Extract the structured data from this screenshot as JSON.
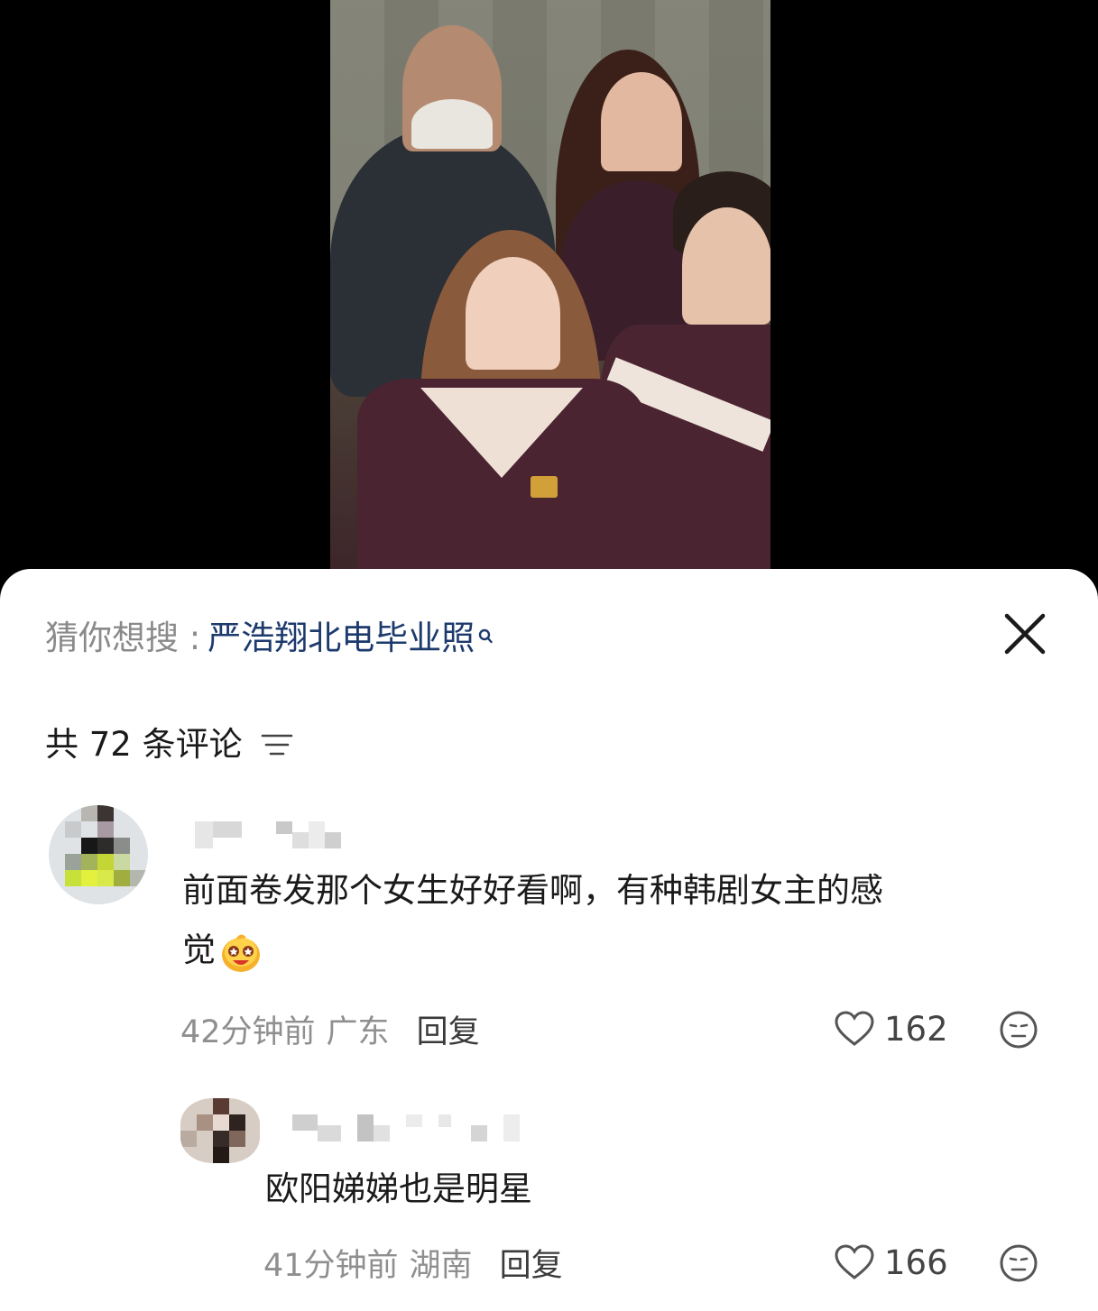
{
  "search_suggestion": {
    "label": "猜你想搜 : ",
    "query": "严浩翔北电毕业照",
    "accent_color": "#1d3a6d"
  },
  "comments_header": {
    "count_text": "共 72 条评论"
  },
  "comments": [
    {
      "text_line1": "前面卷发那个女生好好看啊，有种韩剧女主的感",
      "text_line2": "觉",
      "emoji": "star-eyes-smiley-emoji",
      "time": "42分钟前",
      "location": "广东",
      "reply_label": "回复",
      "likes": "162"
    },
    {
      "text": "欧阳娣娣也是明星",
      "time": "41分钟前",
      "location": "湖南",
      "reply_label": "回复",
      "likes": "166"
    }
  ],
  "icons": {
    "close": "close-icon",
    "sort": "sort-icon",
    "search": "search-icon",
    "like": "heart-icon",
    "react": "neutral-face-icon"
  }
}
